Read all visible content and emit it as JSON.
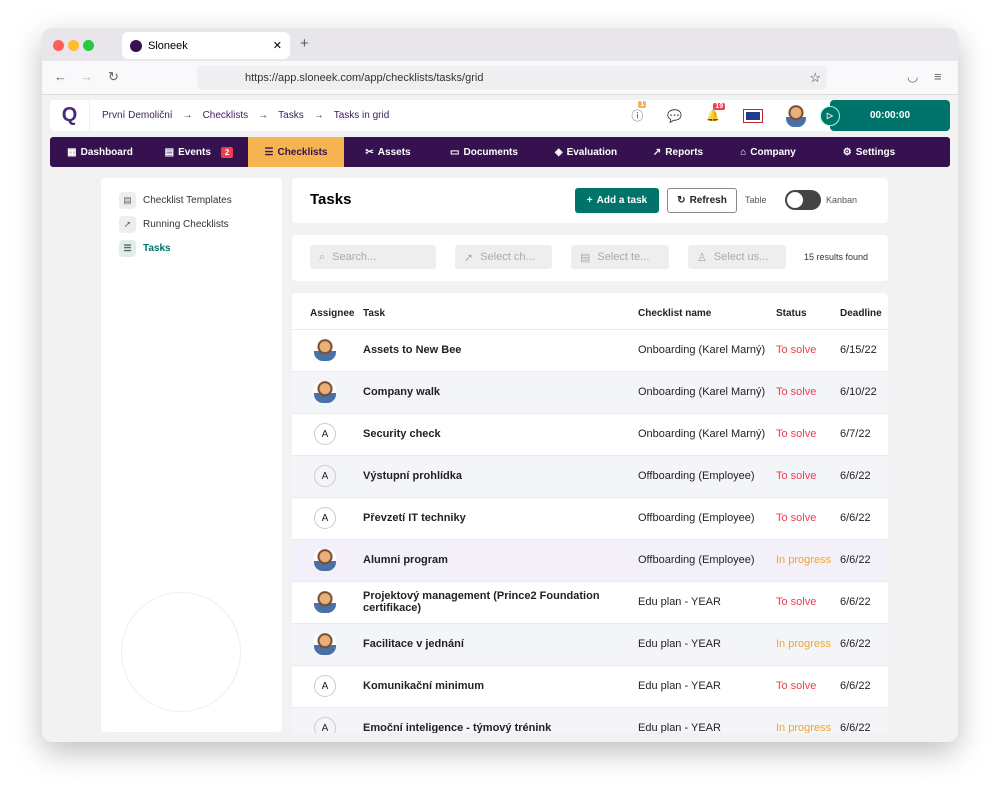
{
  "browser": {
    "tab_title": "Sloneek",
    "url": "https://app.sloneek.com/app/checklists/tasks/grid"
  },
  "header": {
    "breadcrumb": [
      "První Demoliční",
      "Checklists",
      "Tasks",
      "Tasks in grid"
    ],
    "alerts_badge": "1",
    "notifications_badge": "19",
    "timer": "00:00:00"
  },
  "menu": [
    {
      "label": "Dashboard",
      "icon": "grid-icon"
    },
    {
      "label": "Events",
      "icon": "calendar-icon",
      "badge": "2"
    },
    {
      "label": "Checklists",
      "icon": "checklist-icon",
      "active": true
    },
    {
      "label": "Assets",
      "icon": "tools-icon"
    },
    {
      "label": "Documents",
      "icon": "folder-icon"
    },
    {
      "label": "Evaluation",
      "icon": "evaluation-icon"
    },
    {
      "label": "Reports",
      "icon": "chart-icon"
    },
    {
      "label": "Company",
      "icon": "building-icon"
    },
    {
      "label": "Settings",
      "icon": "gear-icon"
    }
  ],
  "sidebar": {
    "items": [
      {
        "label": "Checklist Templates"
      },
      {
        "label": "Running Checklists"
      },
      {
        "label": "Tasks",
        "active": true
      }
    ]
  },
  "toolbar": {
    "title": "Tasks",
    "add_label": "Add a task",
    "refresh_label": "Refresh",
    "table_label": "Table",
    "kanban_label": "Kanban",
    "view_kanban": false
  },
  "filters": {
    "search": "Search...",
    "checklist": "Select ch...",
    "template": "Select te...",
    "user": "Select us...",
    "results": "15 results found"
  },
  "table": {
    "columns": [
      "Assignee",
      "Task",
      "Checklist name",
      "Status",
      "Deadline"
    ],
    "rows": [
      {
        "avatar": "pic",
        "task": "Assets to New Bee",
        "checklist": "Onboarding (Karel Marný)",
        "status": "To solve",
        "deadline": "6/15/22"
      },
      {
        "avatar": "pic",
        "task": "Company walk",
        "checklist": "Onboarding (Karel Marný)",
        "status": "To solve",
        "deadline": "6/10/22"
      },
      {
        "avatar": "A",
        "task": "Security check",
        "checklist": "Onboarding (Karel Marný)",
        "status": "To solve",
        "deadline": "6/7/22"
      },
      {
        "avatar": "A",
        "task": "Výstupní prohlídka",
        "checklist": "Offboarding (Employee)",
        "status": "To solve",
        "deadline": "6/6/22"
      },
      {
        "avatar": "A",
        "task": "Převzetí IT techniky",
        "checklist": "Offboarding (Employee)",
        "status": "To solve",
        "deadline": "6/6/22"
      },
      {
        "avatar": "pic",
        "task": "Alumni program",
        "checklist": "Offboarding (Employee)",
        "status": "In progress",
        "deadline": "6/6/22"
      },
      {
        "avatar": "pic",
        "task": "Projektový management (Prince2 Foundation certifikace)",
        "checklist": "Edu plan - YEAR",
        "status": "To solve",
        "deadline": "6/6/22"
      },
      {
        "avatar": "pic",
        "task": "Facilitace v jednání",
        "checklist": "Edu plan - YEAR",
        "status": "In progress",
        "deadline": "6/6/22"
      },
      {
        "avatar": "A",
        "task": "Komunikační minimum",
        "checklist": "Edu plan - YEAR",
        "status": "To solve",
        "deadline": "6/6/22"
      },
      {
        "avatar": "A",
        "task": "Emoční inteligence - týmový trénink",
        "checklist": "Edu plan - YEAR",
        "status": "In progress",
        "deadline": "6/6/22"
      }
    ]
  },
  "colors": {
    "primary": "#00736a",
    "menu": "#35124f",
    "active": "#f5b44f",
    "to_solve": "#f03c4e",
    "in_progress": "#f5a623"
  }
}
